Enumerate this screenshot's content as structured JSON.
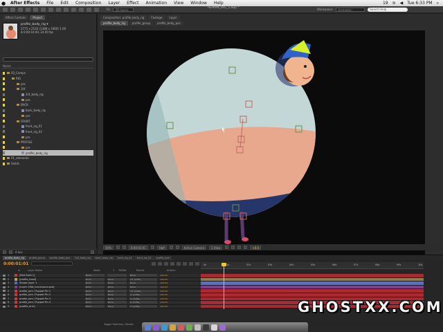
{
  "menubar": {
    "app_name": "After Effects",
    "items": [
      "File",
      "Edit",
      "Composition",
      "Layer",
      "Effect",
      "Animation",
      "View",
      "Window",
      "Help"
    ],
    "battery": "19",
    "clock": "Tue 6:33 PM"
  },
  "toolbar": {
    "window_title": "HEAVIN_RIG_5.aep *",
    "workspace_label": "Workspace:",
    "workspace_value": "Animation",
    "search_placeholder": "Search Help",
    "snap_label": "Tail",
    "snap_value": "3D layers"
  },
  "project_panel": {
    "tabs": [
      "Effect Controls",
      "Project"
    ],
    "selected_name": "profile_body_rig ▾",
    "info_line1": "2775 x 2120 (1388 x 1060) 1.00",
    "info_line2": "Δ 0:00:10:00, 24.00 fps",
    "column_name": "Name",
    "tree": [
      {
        "label": "03_Comps",
        "type": "folder",
        "indent": 0,
        "color": "yellow"
      },
      {
        "label": "RIG",
        "type": "folder",
        "indent": 1,
        "color": "yellow"
      },
      {
        "label": "pre",
        "type": "folder",
        "indent": 2,
        "color": "yellow"
      },
      {
        "label": "3/4",
        "type": "folder",
        "indent": 2,
        "color": "yellow"
      },
      {
        "label": "3/4_body_rig",
        "type": "comp",
        "indent": 3,
        "color": "gray"
      },
      {
        "label": "pre",
        "type": "folder",
        "indent": 3,
        "color": "yellow"
      },
      {
        "label": "BACK",
        "type": "folder",
        "indent": 2,
        "color": "yellow"
      },
      {
        "label": "back_body_rig",
        "type": "comp",
        "indent": 3,
        "color": "gray"
      },
      {
        "label": "pre",
        "type": "folder",
        "indent": 3,
        "color": "yellow"
      },
      {
        "label": "FRONT",
        "type": "folder",
        "indent": 2,
        "color": "yellow"
      },
      {
        "label": "front_rig_01",
        "type": "comp",
        "indent": 3,
        "color": "gray"
      },
      {
        "label": "front_rig_02",
        "type": "comp",
        "indent": 3,
        "color": "gray"
      },
      {
        "label": "pre",
        "type": "folder",
        "indent": 3,
        "color": "yellow"
      },
      {
        "label": "PROFILE",
        "type": "folder",
        "indent": 2,
        "color": "yellow"
      },
      {
        "label": "pre",
        "type": "folder",
        "indent": 3,
        "color": "yellow"
      },
      {
        "label": "profile_body_rig",
        "type": "comp",
        "indent": 3,
        "color": "gray",
        "selected": true
      },
      {
        "label": "01_elements",
        "type": "folder",
        "indent": 0,
        "color": "yellow"
      },
      {
        "label": "Solids",
        "type": "folder",
        "indent": 0,
        "color": "yellow"
      }
    ],
    "footer_bpc": "8 bpc"
  },
  "viewer": {
    "tabs": [
      "Composition: profile_body_rig",
      "Footage",
      "Layer"
    ],
    "breadcrumbs": [
      "profile_body_rig",
      "profile_group",
      "profile_body_pos"
    ],
    "zoom": "50%",
    "timecode": "0:00:01:01",
    "resolution": "Half",
    "camera": "Active Camera",
    "views": "1 View",
    "exposure": "+0.0"
  },
  "timeline": {
    "tabs": [
      "profile_body_rig",
      "profile_group",
      "profile_body_pos",
      "3/4_body_rig",
      "back_body_rig",
      "front_rig_01",
      "front_rig_02",
      "profile_arm"
    ],
    "current_time": "0:00:01:01",
    "columns": [
      "#",
      "Layer Name",
      "Mode",
      "T",
      "TrkMat",
      "Parent",
      "Stretch"
    ],
    "ruler": [
      "0s",
      "01s",
      "02s",
      "03s",
      "04s",
      "05s",
      "06s",
      "07s",
      "08s",
      "09s",
      "10s"
    ],
    "layers": [
      {
        "num": "1",
        "name": "[Red Solid 1]",
        "color": "#c23c3c",
        "mode": "Norm",
        "trkmat": "",
        "parent": "None",
        "stretch": "100.0%",
        "bar": "#a82a33"
      },
      {
        "num": "2",
        "name": "[profile_head]",
        "color": "#b9a460",
        "mode": "Norm",
        "trkmat": "None",
        "parent": "13. profile_",
        "stretch": "100.0%",
        "bar": "#8b7e4c"
      },
      {
        "num": "3",
        "name": "Shape Layer 1",
        "color": "#4b6cc4",
        "mode": "Norm",
        "trkmat": "None",
        "parent": "None",
        "stretch": "100.0%",
        "bar": "#5b6fc9"
      },
      {
        "num": "4",
        "name": "[Layer 3/fat_turnaround.psd]",
        "color": "#7b3e8c",
        "mode": "Norm",
        "trkmat": "None",
        "parent": "None",
        "stretch": "100.0%",
        "bar": "#7f3e95"
      },
      {
        "num": "5",
        "name": "profile_arm / Puppet Pin 1",
        "color": "#c23c3c",
        "mode": "Norm",
        "trkmat": "None",
        "parent": "13. profile_",
        "stretch": "100.0%",
        "bar": "#a82a33"
      },
      {
        "num": "6",
        "name": "profile_arm / Puppet Pin 2",
        "color": "#c23c3c",
        "mode": "Norm",
        "trkmat": "None",
        "parent": "4. profile_",
        "stretch": "100.0%",
        "bar": "#a82a33"
      },
      {
        "num": "7",
        "name": "profile_arm / Puppet Pin 3",
        "color": "#c23c3c",
        "mode": "Norm",
        "trkmat": "None",
        "parent": "5. profile_",
        "stretch": "100.0%",
        "bar": "#a82a33"
      },
      {
        "num": "8",
        "name": "profile_arm / Puppet Pin 4",
        "color": "#c23c3c",
        "mode": "Norm",
        "trkmat": "None",
        "parent": "6. profile_",
        "stretch": "100.0%",
        "bar": "#a82a33"
      },
      {
        "num": "9",
        "name": "[profile_arm]",
        "color": "#c23c3c",
        "mode": "Norm",
        "trkmat": "None",
        "parent": "7. profile_",
        "stretch": "100.0%",
        "bar": "#a82a33"
      }
    ],
    "footer": "Toggle Switches / Modes"
  },
  "watermark": "GHOSTXX.COM",
  "colors": {
    "accent_timecode": "#e8a227",
    "playhead": "#e8c638",
    "body_top": "#c3d7d6",
    "body_bottom": "#e7a88d",
    "body_pants": "#26356a"
  }
}
